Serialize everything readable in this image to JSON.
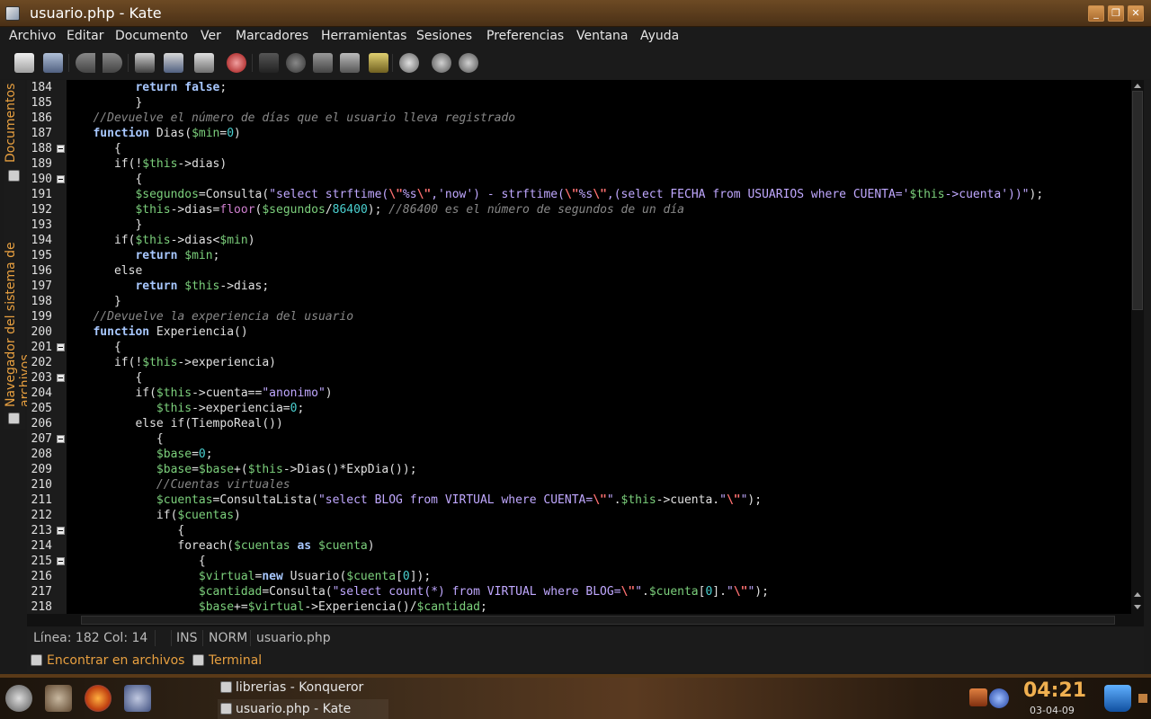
{
  "window": {
    "title": "usuario.php - Kate",
    "buttons": [
      "minimize",
      "maximize",
      "close"
    ]
  },
  "menu": [
    "Archivo",
    "Editar",
    "Documento",
    "Ver",
    "Marcadores",
    "Herramientas",
    "Sesiones",
    "Preferencias",
    "Ventana",
    "Ayuda"
  ],
  "toolbar": {
    "icons": [
      "new-file-icon",
      "open-file-icon",
      "back-icon",
      "forward-icon",
      "save-icon",
      "save-as-icon",
      "print-icon",
      "close-file-icon",
      "undo-icon",
      "redo-icon",
      "cut-icon",
      "copy-icon",
      "paste-icon",
      "find-icon",
      "find-next-icon",
      "replace-icon"
    ]
  },
  "sidetabs": {
    "documents": "Documentos",
    "filesystem": "Navegador del sistema de archivos"
  },
  "editor": {
    "first_line": 184,
    "lines": [
      {
        "n": "184",
        "fold": false,
        "html": "         <span class=\"kw\">return</span> <span class=\"kw\">false</span>;"
      },
      {
        "n": "185",
        "fold": false,
        "html": "         }"
      },
      {
        "n": "186",
        "fold": false,
        "html": "   <span class=\"cmt\">//Devuelve el número de días que el usuario lleva registrado</span>"
      },
      {
        "n": "187",
        "fold": false,
        "html": "   <span class=\"kw\">function</span> Dias(<span class=\"var\">$min</span>=<span class=\"num\">0</span>)"
      },
      {
        "n": "188",
        "fold": true,
        "html": "      {"
      },
      {
        "n": "189",
        "fold": false,
        "html": "      if(!<span class=\"var\">$this</span>->dias)"
      },
      {
        "n": "190",
        "fold": true,
        "html": "         {"
      },
      {
        "n": "191",
        "fold": false,
        "html": "         <span class=\"var\">$segundos</span>=Consulta(<span class=\"str\">\"select strftime(</span><span class=\"bs\">\\\"</span><span class=\"str\">%s</span><span class=\"bs\">\\\"</span><span class=\"str\">,'now') - strftime(</span><span class=\"bs\">\\\"</span><span class=\"str\">%s</span><span class=\"bs\">\\\"</span><span class=\"str\">,(select FECHA from USUARIOS where CUENTA='</span><span class=\"var\">$this</span><span class=\"str\">->cuenta'))\"</span>);"
      },
      {
        "n": "192",
        "fold": false,
        "html": "         <span class=\"var\">$this</span>->dias=<span class=\"fn\">floor</span>(<span class=\"var\">$segundos</span>/<span class=\"num\">86400</span>); <span class=\"cmt\">//86400 es el número de segundos de un día</span>"
      },
      {
        "n": "193",
        "fold": false,
        "html": "         }"
      },
      {
        "n": "194",
        "fold": false,
        "html": "      if(<span class=\"var\">$this</span>->dias<<span class=\"var\">$min</span>)"
      },
      {
        "n": "195",
        "fold": false,
        "html": "         <span class=\"kw\">return</span> <span class=\"var\">$min</span>;"
      },
      {
        "n": "196",
        "fold": false,
        "html": "      else"
      },
      {
        "n": "197",
        "fold": false,
        "html": "         <span class=\"kw\">return</span> <span class=\"var\">$this</span>->dias;"
      },
      {
        "n": "198",
        "fold": false,
        "html": "      }"
      },
      {
        "n": "199",
        "fold": false,
        "html": "   <span class=\"cmt\">//Devuelve la experiencia del usuario</span>"
      },
      {
        "n": "200",
        "fold": false,
        "html": "   <span class=\"kw\">function</span> Experiencia()"
      },
      {
        "n": "201",
        "fold": true,
        "html": "      {"
      },
      {
        "n": "202",
        "fold": false,
        "html": "      if(!<span class=\"var\">$this</span>->experiencia)"
      },
      {
        "n": "203",
        "fold": true,
        "html": "         {"
      },
      {
        "n": "204",
        "fold": false,
        "html": "         if(<span class=\"var\">$this</span>->cuenta==<span class=\"str\">\"anonimo\"</span>)"
      },
      {
        "n": "205",
        "fold": false,
        "html": "            <span class=\"var\">$this</span>->experiencia=<span class=\"num\">0</span>;"
      },
      {
        "n": "206",
        "fold": false,
        "html": "         else if(TiempoReal())"
      },
      {
        "n": "207",
        "fold": true,
        "html": "            {"
      },
      {
        "n": "208",
        "fold": false,
        "html": "            <span class=\"var\">$base</span>=<span class=\"num\">0</span>;"
      },
      {
        "n": "209",
        "fold": false,
        "html": "            <span class=\"var\">$base</span>=<span class=\"var\">$base</span>+(<span class=\"var\">$this</span>->Dias()*ExpDia());"
      },
      {
        "n": "210",
        "fold": false,
        "html": "            <span class=\"cmt\">//Cuentas virtuales</span>"
      },
      {
        "n": "211",
        "fold": false,
        "html": "            <span class=\"var\">$cuentas</span>=ConsultaLista(<span class=\"str\">\"select BLOG from VIRTUAL where CUENTA=</span><span class=\"bs\">\\\"</span><span class=\"str\">\"</span>.<span class=\"var\">$this</span>->cuenta.<span class=\"str\">\"</span><span class=\"bs\">\\\"</span><span class=\"str\">\"</span>);"
      },
      {
        "n": "212",
        "fold": false,
        "html": "            if(<span class=\"var\">$cuentas</span>)"
      },
      {
        "n": "213",
        "fold": true,
        "html": "               {"
      },
      {
        "n": "214",
        "fold": false,
        "html": "               foreach(<span class=\"var\">$cuentas</span> <span class=\"kw\">as</span> <span class=\"var\">$cuenta</span>)"
      },
      {
        "n": "215",
        "fold": true,
        "html": "                  {"
      },
      {
        "n": "216",
        "fold": false,
        "html": "                  <span class=\"var\">$virtual</span>=<span class=\"kw\">new</span> Usuario(<span class=\"var\">$cuenta</span>[<span class=\"num\">0</span>]);"
      },
      {
        "n": "217",
        "fold": false,
        "html": "                  <span class=\"var\">$cantidad</span>=Consulta(<span class=\"str\">\"select count(*) from VIRTUAL where BLOG=</span><span class=\"bs\">\\\"</span><span class=\"str\">\"</span>.<span class=\"var\">$cuenta</span>[<span class=\"num\">0</span>].<span class=\"str\">\"</span><span class=\"bs\">\\\"</span><span class=\"str\">\"</span>);"
      },
      {
        "n": "218",
        "fold": false,
        "html": "                  <span class=\"var\">$base</span>+=<span class=\"var\">$virtual</span>->Experiencia()/<span class=\"var\">$cantidad</span>;"
      }
    ]
  },
  "statusbar": {
    "position": "Línea: 182 Col: 14",
    "mode": "INS",
    "input": "NORM",
    "file": "usuario.php"
  },
  "tooltabs": [
    "Encontrar en archivos",
    "Terminal"
  ],
  "taskbar": {
    "tasks": [
      "librerias - Konqueror",
      "usuario.php - Kate"
    ],
    "time": "04:21",
    "date": "03-04-09"
  }
}
